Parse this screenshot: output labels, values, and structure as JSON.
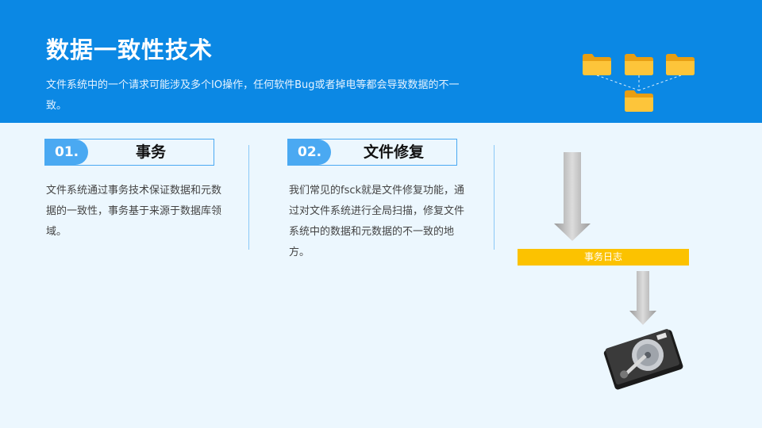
{
  "header": {
    "title": "数据一致性技术",
    "subtitle": "文件系统中的一个请求可能涉及多个IO操作，任何软件Bug或者掉电等都会导致数据的不一致。"
  },
  "sections": [
    {
      "number": "01.",
      "title": "事务",
      "text": "文件系统通过事务技术保证数据和元数据的一致性，事务基于来源于数据库领域。"
    },
    {
      "number": "02.",
      "title": "文件修复",
      "text": "我们常见的fsck就是文件修复功能，通过对文件系统进行全局扫描，修复文件系统中的数据和元数据的不一致的地方。"
    }
  ],
  "diagram": {
    "journal_label": "事务日志",
    "icons": [
      "folder-icon",
      "folder-icon",
      "folder-icon",
      "folder-icon",
      "arrow-down-icon",
      "hard-disk-icon"
    ]
  },
  "colors": {
    "header_bg": "#0b88e4",
    "page_bg": "#ecf7fe",
    "accent": "#4aa9f2",
    "journal": "#fcc200",
    "folder": "#f9b81e"
  }
}
